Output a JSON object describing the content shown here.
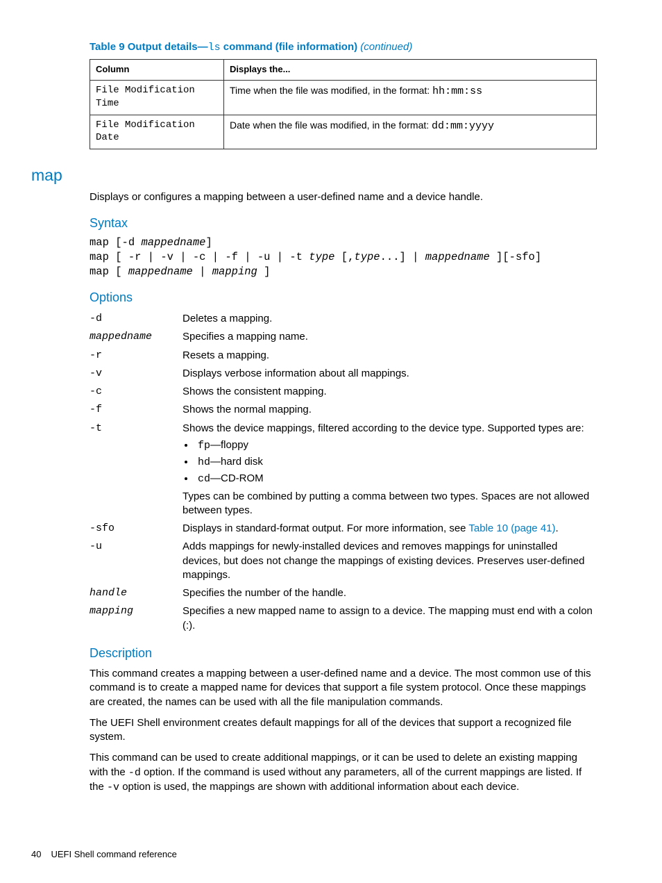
{
  "table9": {
    "title_pre": "Table 9 Output details—",
    "title_cmd": "ls",
    "title_post": " command (file information) ",
    "title_cont": "(continued)",
    "head_col": "Column",
    "head_disp": "Displays the...",
    "rows": [
      {
        "col": "File Modification\nTime",
        "disp_pre": "Time when the file was modified, in the format: ",
        "disp_mono": "hh:mm:ss"
      },
      {
        "col": "File Modification\nDate",
        "disp_pre": "Date when the file was modified, in the format: ",
        "disp_mono": "dd:mm:yyyy"
      }
    ]
  },
  "cmd": {
    "name": "map",
    "intro": "Displays or configures a mapping between a user-defined name and a device handle."
  },
  "syntax": {
    "heading": "Syntax",
    "l1a": "map",
    "l1b": "[-d ",
    "l1c": "mappedname",
    "l1d": "]",
    "l2a": "map",
    "l2b": "[ -r | -v | -c | -f | -u | -t ",
    "l2c": "type",
    "l2d": " [,",
    "l2e": "type",
    "l2f": "...] | ",
    "l2g": "mappedname",
    "l2h": " ][-sfo]",
    "l3a": "map",
    "l3b": "[ ",
    "l3c": "mappedname",
    "l3d": " | ",
    "l3e": "mapping",
    "l3f": " ]"
  },
  "options": {
    "heading": "Options",
    "rows": {
      "d": {
        "term": "-d",
        "def": "Deletes a mapping."
      },
      "mn": {
        "term": "mappedname",
        "def": "Specifies a mapping name."
      },
      "r": {
        "term": "-r",
        "def": "Resets a mapping."
      },
      "v": {
        "term": "-v",
        "def": "Displays verbose information about all mappings."
      },
      "c": {
        "term": "-c",
        "def": "Shows the consistent mapping."
      },
      "f": {
        "term": "-f",
        "def": "Shows the normal mapping."
      },
      "t": {
        "term": "-t",
        "def1": "Shows the device mappings, filtered according to the device type. Supported types are:",
        "types": {
          "fp": {
            "code": "fp",
            "txt": "—floppy"
          },
          "hd": {
            "code": "hd",
            "txt": "—hard disk"
          },
          "cd": {
            "code": "cd",
            "txt": "—CD-ROM"
          }
        },
        "def2": "Types can be combined by putting a comma between two types. Spaces are not allowed between types."
      },
      "sfo": {
        "term": "-sfo",
        "def_pre": "Displays in standard-format output. For more information, see ",
        "def_link": "Table 10 (page 41)",
        "def_post": "."
      },
      "u": {
        "term": "-u",
        "def": "Adds mappings for newly-installed devices and removes mappings for uninstalled devices, but does not change the mappings of existing devices. Preserves user-defined mappings."
      },
      "handle": {
        "term": "handle",
        "def": "Specifies the number of the handle."
      },
      "mapping": {
        "term": "mapping",
        "def": "Specifies a new mapped name to assign to a device. The mapping must end with a colon (:)."
      }
    }
  },
  "description": {
    "heading": "Description",
    "p1": "This command creates a mapping between a user-defined name and a device. The most common use of this command is to create a mapped name for devices that support a file system protocol. Once these mappings are created, the names can be used with all the file manipulation commands.",
    "p2": "The UEFI Shell environment creates default mappings for all of the devices that support a recognized file system.",
    "p3a": "This command can be used to create additional mappings, or it can be used to delete an existing mapping with the ",
    "p3b": "-d",
    "p3c": " option. If the command is used without any parameters, all of the current mappings are listed. If the ",
    "p3d": "-v",
    "p3e": " option is used, the mappings are shown with additional information about each device."
  },
  "footer": {
    "page": "40",
    "title": "UEFI Shell command reference"
  }
}
